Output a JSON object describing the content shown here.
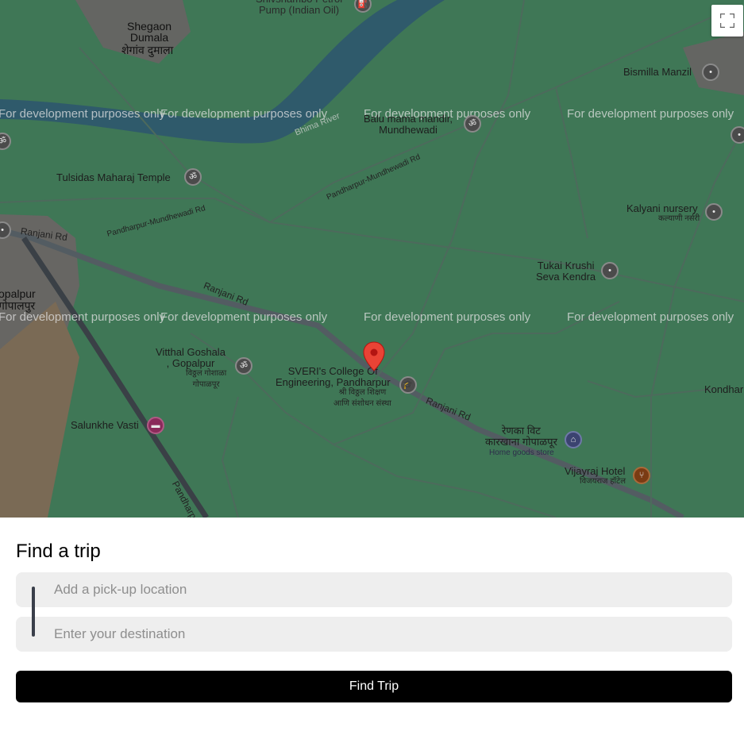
{
  "map": {
    "watermark": "For development purposes only",
    "places": {
      "shegaon": "Shegaon\nDumala",
      "shegaon_local": "शेगांव दुमाला",
      "petrol": "Shivshambo Petrol\nPump (Indian Oil)",
      "bismilla": "Bismilla Manzil",
      "bhima": "Bhima River",
      "balu": "Balu mama mandir,\nMundhewadi",
      "tulsidas": "Tulsidas Maharaj Temple",
      "kalyani": "Kalyani nursery",
      "kalyani_local": "कल्याणी नर्सरी",
      "tukai": "Tukai Krushi\nSeva Kendra",
      "gopalpur": "opalpur",
      "gopalpur_local": "गोपालपुर",
      "vitthal": "Vitthal Goshala\n, Gopalpur",
      "vitthal_local": "विठ्ठल गोशाळा\nगोपाळपूर",
      "sveri": "SVERI's College Of\nEngineering, Pandharpur",
      "sveri_local": "श्री विठ्ठल शिक्षण\nआणि संशोधन संस्था",
      "kondhar": "Kondhar",
      "salunkhe": "Salunkhe Vasti",
      "renuka": "रेणका विट\nकारखाना गोपाळपूर",
      "renuka_sub": "Home goods store",
      "vijayraj": "Vijayraj Hotel",
      "vijayraj_local": "विजयराज हॉटेल"
    },
    "roads": {
      "ranjani": "Ranjani Rd",
      "mundhewadi": "Pandharpur-Mundhewadi Rd",
      "pandharpur": "Pandharpur"
    },
    "fullscreen_icon": "fullscreen-icon",
    "marker_icon": "map-marker-icon"
  },
  "panel": {
    "title": "Find a trip",
    "pickup_placeholder": "Add a pick-up location",
    "destination_placeholder": "Enter your destination",
    "pickup_value": "",
    "destination_value": "",
    "button_label": "Find Trip"
  },
  "colors": {
    "map_base": "#3f7756",
    "button_bg": "#000000",
    "field_bg": "#eeeeee"
  }
}
